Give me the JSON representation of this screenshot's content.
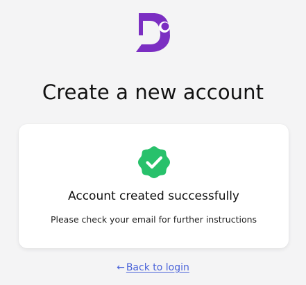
{
  "brand": {
    "logo_icon": "brand-logo-icon",
    "logo_color": "#7b2ec2"
  },
  "header": {
    "title": "Create a new account"
  },
  "card": {
    "icon": "check-badge-icon",
    "icon_color": "#28c16b",
    "title": "Account created successfully",
    "message": "Please check your email for further instructions"
  },
  "footer": {
    "back_icon": "left-arrow-icon",
    "back_label": "Back to login",
    "link_color": "#4a63d9"
  }
}
